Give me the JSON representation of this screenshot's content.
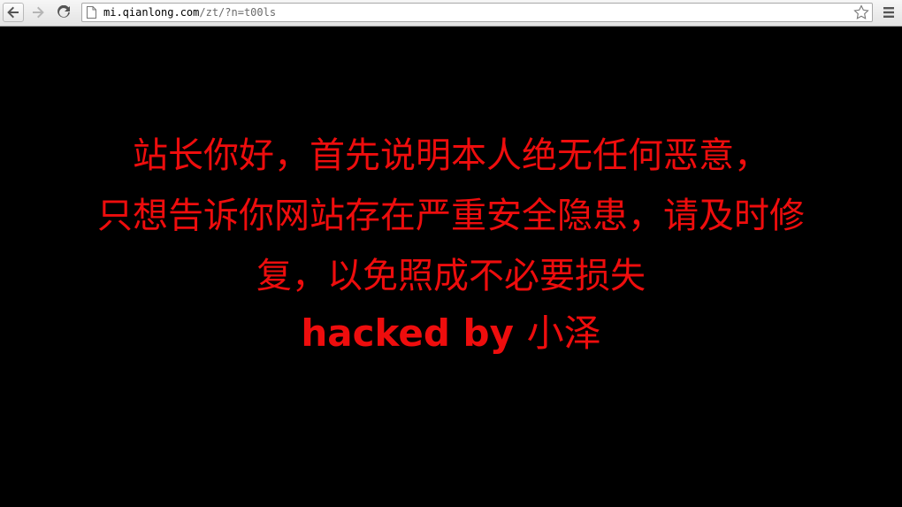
{
  "browser": {
    "url_host": "mi.qianlong.com",
    "url_path": "/zt/?n=t00ls",
    "icons": {
      "back": "back-arrow-icon",
      "forward": "forward-arrow-icon",
      "reload": "reload-icon",
      "page": "page-icon",
      "bookmark": "star-icon",
      "menu": "hamburger-menu-icon"
    }
  },
  "page": {
    "background": "#000000",
    "text_color": "#ee0d0d",
    "line1": "站长你好，首先说明本人绝无任何恶意，",
    "line2": "只想告诉你网站存在严重安全隐患，请及时修",
    "line3": "复，以免照成不必要损失",
    "signature_latin": "hacked by ",
    "signature_name": "小泽"
  }
}
